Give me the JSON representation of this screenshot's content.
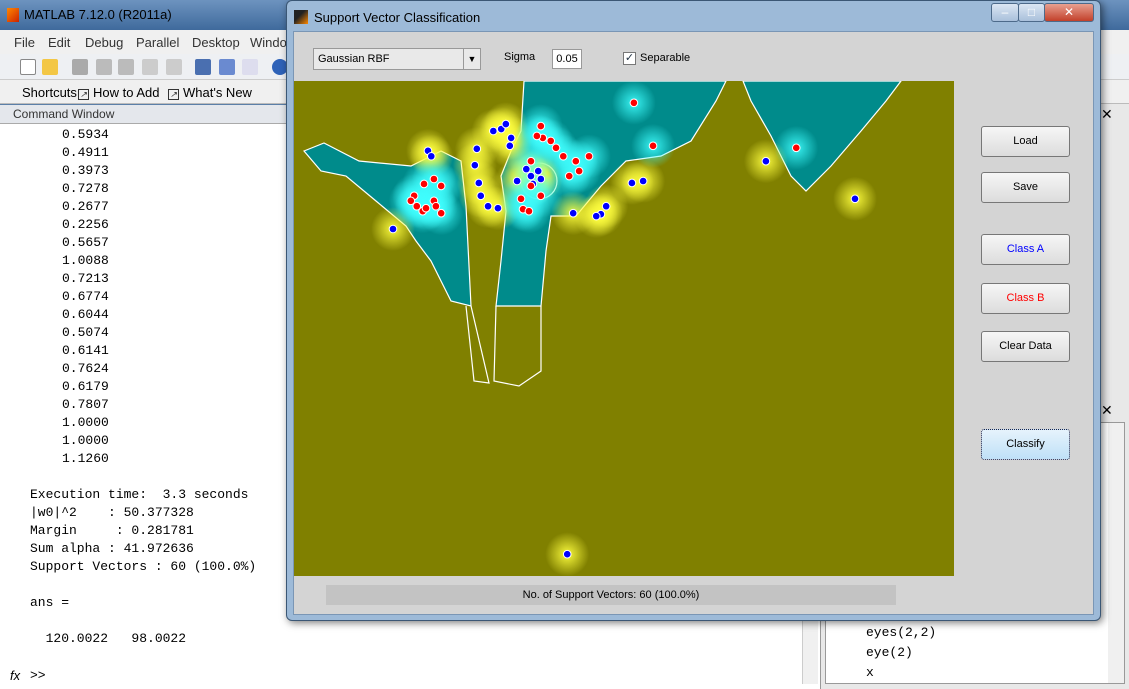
{
  "matlab": {
    "title": "MATLAB  7.12.0 (R2011a)",
    "menu": [
      "File",
      "Edit",
      "Debug",
      "Parallel",
      "Desktop",
      "Windo"
    ],
    "shortcuts": {
      "label": "Shortcuts",
      "items": [
        "How to Add",
        "What's New"
      ]
    },
    "command_window": {
      "title": "Command Window",
      "values": [
        "0.5934",
        "0.4911",
        "0.3973",
        "0.7278",
        "0.2677",
        "0.2256",
        "0.5657",
        "1.0088",
        "0.7213",
        "0.6774",
        "0.6044",
        "0.5074",
        "0.6141",
        "0.7624",
        "0.6179",
        "0.7807",
        "1.0000",
        "1.0000",
        "1.1260"
      ],
      "summary": [
        "Execution time:  3.3 seconds",
        "|w0|^2    : 50.377328",
        "Margin     : 0.281781",
        "Sum alpha : 41.972636",
        "Support Vectors : 60 (100.0%)"
      ],
      "ans_label": "ans =",
      "ans_value": "  120.0022   98.0022",
      "prompt": ">>",
      "fx": "fx"
    },
    "workspace_history": [
      "eyes(2,2)",
      "eye(2)",
      "x"
    ]
  },
  "dialog": {
    "title": "Support Vector Classification",
    "kernel": "Gaussian RBF",
    "sigma_label": "Sigma",
    "sigma_value": "0.05",
    "separable_label": "Separable",
    "separable_checked": true,
    "buttons": {
      "load": "Load",
      "save": "Save",
      "class_a": "Class A",
      "class_b": "Class B",
      "clear": "Clear Data",
      "classify": "Classify"
    },
    "status": "No. of Support Vectors: 60 (100.0%)",
    "colors": {
      "class_a": "#0000ff",
      "class_b": "#ff0000",
      "region_a": "#808000",
      "region_b": "#008b8b",
      "boundary": "#ffffff"
    }
  },
  "chart_data": {
    "type": "scatter",
    "xlim": [
      0,
      100
    ],
    "ylim": [
      0,
      100
    ],
    "grid": false,
    "series": [
      {
        "name": "Class A",
        "color": "#0000ff",
        "points": [
          [
            20.3,
            85.9
          ],
          [
            20.8,
            84.8
          ],
          [
            15.0,
            70.1
          ],
          [
            27.7,
            86.3
          ],
          [
            27.4,
            83.0
          ],
          [
            28.0,
            79.4
          ],
          [
            28.3,
            76.8
          ],
          [
            29.4,
            74.7
          ],
          [
            30.9,
            74.3
          ],
          [
            30.2,
            89.9
          ],
          [
            31.4,
            90.3
          ],
          [
            32.1,
            91.3
          ],
          [
            32.9,
            88.5
          ],
          [
            32.7,
            86.9
          ],
          [
            33.8,
            79.8
          ],
          [
            35.2,
            82.2
          ],
          [
            35.9,
            80.8
          ],
          [
            37.0,
            81.8
          ],
          [
            37.4,
            80.2
          ],
          [
            36.2,
            79.2
          ],
          [
            51.2,
            79.4
          ],
          [
            52.9,
            79.8
          ],
          [
            47.3,
            74.7
          ],
          [
            46.5,
            73.1
          ],
          [
            45.8,
            72.7
          ],
          [
            42.3,
            73.3
          ],
          [
            71.5,
            83.8
          ],
          [
            85.0,
            76.2
          ],
          [
            41.4,
            4.4
          ]
        ]
      },
      {
        "name": "Class B",
        "color": "#ff0000",
        "points": [
          [
            51.5,
            95.6
          ],
          [
            54.4,
            86.9
          ],
          [
            76.1,
            86.5
          ],
          [
            37.4,
            90.9
          ],
          [
            37.7,
            88.5
          ],
          [
            36.8,
            88.9
          ],
          [
            38.9,
            87.9
          ],
          [
            39.7,
            86.5
          ],
          [
            40.8,
            84.8
          ],
          [
            42.7,
            83.8
          ],
          [
            44.7,
            84.8
          ],
          [
            43.2,
            81.8
          ],
          [
            41.7,
            80.8
          ],
          [
            35.9,
            83.8
          ],
          [
            37.4,
            76.8
          ],
          [
            34.4,
            76.2
          ],
          [
            34.7,
            74.1
          ],
          [
            35.6,
            73.7
          ],
          [
            35.9,
            78.8
          ],
          [
            19.7,
            79.2
          ],
          [
            21.2,
            80.2
          ],
          [
            22.3,
            78.8
          ],
          [
            18.2,
            76.8
          ],
          [
            18.6,
            74.7
          ],
          [
            19.5,
            73.7
          ],
          [
            21.2,
            75.8
          ],
          [
            21.5,
            74.7
          ],
          [
            22.3,
            73.3
          ],
          [
            20.0,
            74.3
          ],
          [
            17.7,
            75.8
          ]
        ]
      }
    ]
  }
}
